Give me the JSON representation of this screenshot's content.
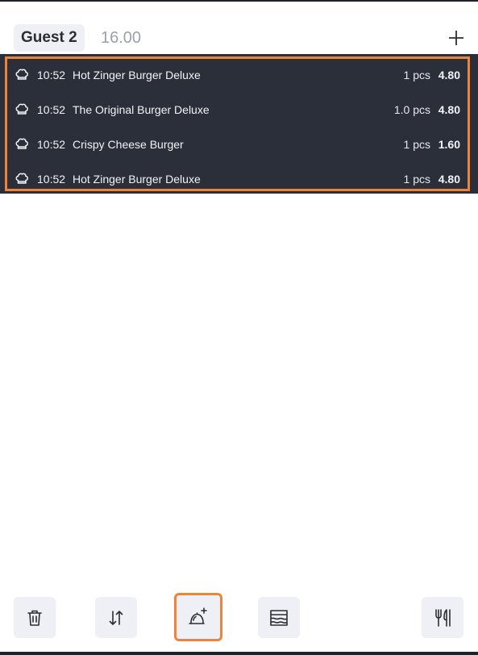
{
  "header": {
    "guest_label": "Guest 2",
    "total": "16.00"
  },
  "orders": [
    {
      "time": "10:52",
      "name": "Hot Zinger Burger Deluxe",
      "qty": "1 pcs",
      "price": "4.80"
    },
    {
      "time": "10:52",
      "name": "The Original Burger Deluxe",
      "qty": "1.0 pcs",
      "price": "4.80"
    },
    {
      "time": "10:52",
      "name": "Crispy Cheese Burger",
      "qty": "1 pcs",
      "price": "1.60"
    },
    {
      "time": "10:52",
      "name": "Hot Zinger Burger Deluxe",
      "qty": "1 pcs",
      "price": "4.80"
    }
  ],
  "icons": {
    "add": "plus-icon",
    "row": "chef-hat-icon",
    "toolbar": [
      "trash-icon",
      "sort-arrows-icon",
      "cloche-add-icon",
      "layers-icon",
      "fork-knife-icon"
    ]
  },
  "colors": {
    "row_bg": "#2b2f3a",
    "accent": "#f0833a",
    "button_bg": "#eef0f5"
  }
}
